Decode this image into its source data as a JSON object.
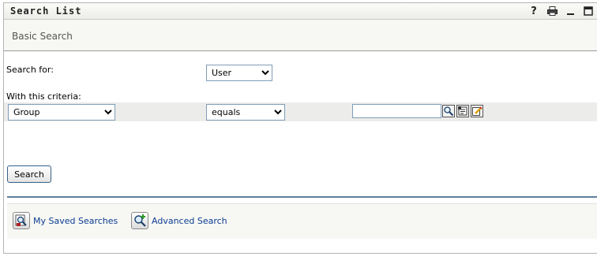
{
  "portlet": {
    "title": "Search List",
    "help_symbol": "?",
    "subtitle": "Basic Search"
  },
  "form": {
    "search_for_label": "Search for:",
    "search_for_value": "User",
    "criteria_label": "With this criteria:",
    "attribute_value": "Group",
    "operator_value": "equals",
    "value_input": ""
  },
  "actions": {
    "search_label": "Search"
  },
  "footer": {
    "saved_searches": "My Saved Searches",
    "advanced_search": "Advanced Search"
  },
  "icons": [
    "help-icon",
    "print-icon",
    "minimize-icon",
    "maximize-icon",
    "object-lookup-icon",
    "history-icon",
    "edit-icon",
    "saved-searches-icon",
    "advanced-search-icon"
  ]
}
